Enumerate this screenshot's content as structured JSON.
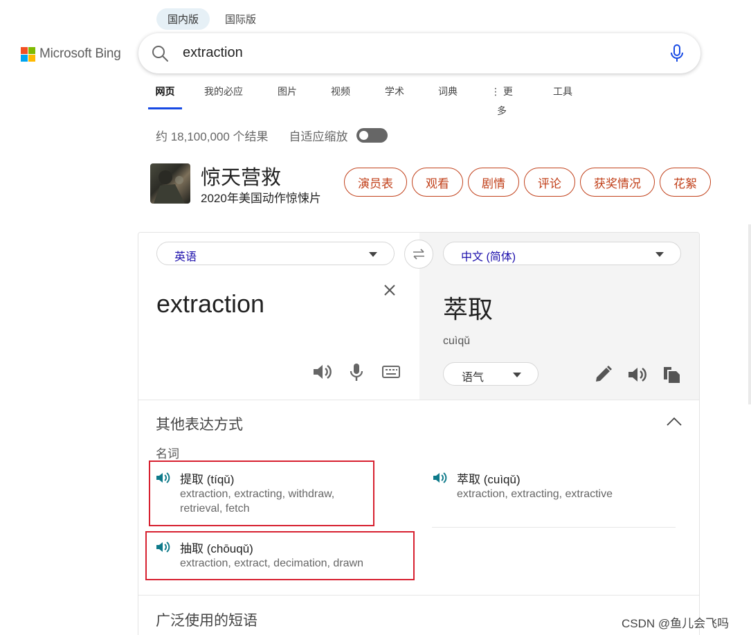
{
  "scope_tabs": [
    "国内版",
    "国际版"
  ],
  "logo": {
    "text": "Microsoft Bing",
    "colors": [
      "#f25022",
      "#7fba00",
      "#00a4ef",
      "#ffb900"
    ]
  },
  "search": {
    "query": "extraction",
    "placeholder": ""
  },
  "nav": {
    "items": [
      "网页",
      "我的必应",
      "图片",
      "视频",
      "学术",
      "词典",
      "⋮ 更多",
      "工具"
    ],
    "active_index": 0
  },
  "results": {
    "count_text": "约 18,100,000 个结果",
    "adaptive_zoom_label": "自适应缩放",
    "adaptive_zoom_on": false
  },
  "movie": {
    "title": "惊天营救",
    "subtitle": "2020年美国动作惊悚片",
    "chips": [
      "演员表",
      "观看",
      "剧情",
      "评论",
      "获奖情况",
      "花絮"
    ]
  },
  "translator": {
    "source_lang": "英语",
    "target_lang": "中文 (简体)",
    "source_text": "extraction",
    "target_text": "萃取",
    "pinyin": "cuìqǔ",
    "tone_label": "语气",
    "alternatives_title": "其他表达方式",
    "part_of_speech": "名词",
    "alternatives": [
      {
        "term": "提取 (tíqǔ)",
        "synonyms_line1": "extraction, extracting, withdraw,",
        "synonyms_line2": "retrieval, fetch"
      },
      {
        "term": "萃取 (cuìqǔ)",
        "synonyms_line1": "extraction, extracting, extractive",
        "synonyms_line2": ""
      },
      {
        "term": "抽取 (chōuqǔ)",
        "synonyms_line1": "extraction, extract, decimation, drawn",
        "synonyms_line2": ""
      }
    ],
    "phrases_title": "广泛使用的短语"
  },
  "watermark": "CSDN @鱼儿会飞吗",
  "colors": {
    "accent_blue": "#174ae4",
    "chip_orange": "#c1401a",
    "link_blue": "#1a0dab",
    "speaker_teal": "#0e7a8a",
    "highlight_red": "#d7202f"
  }
}
